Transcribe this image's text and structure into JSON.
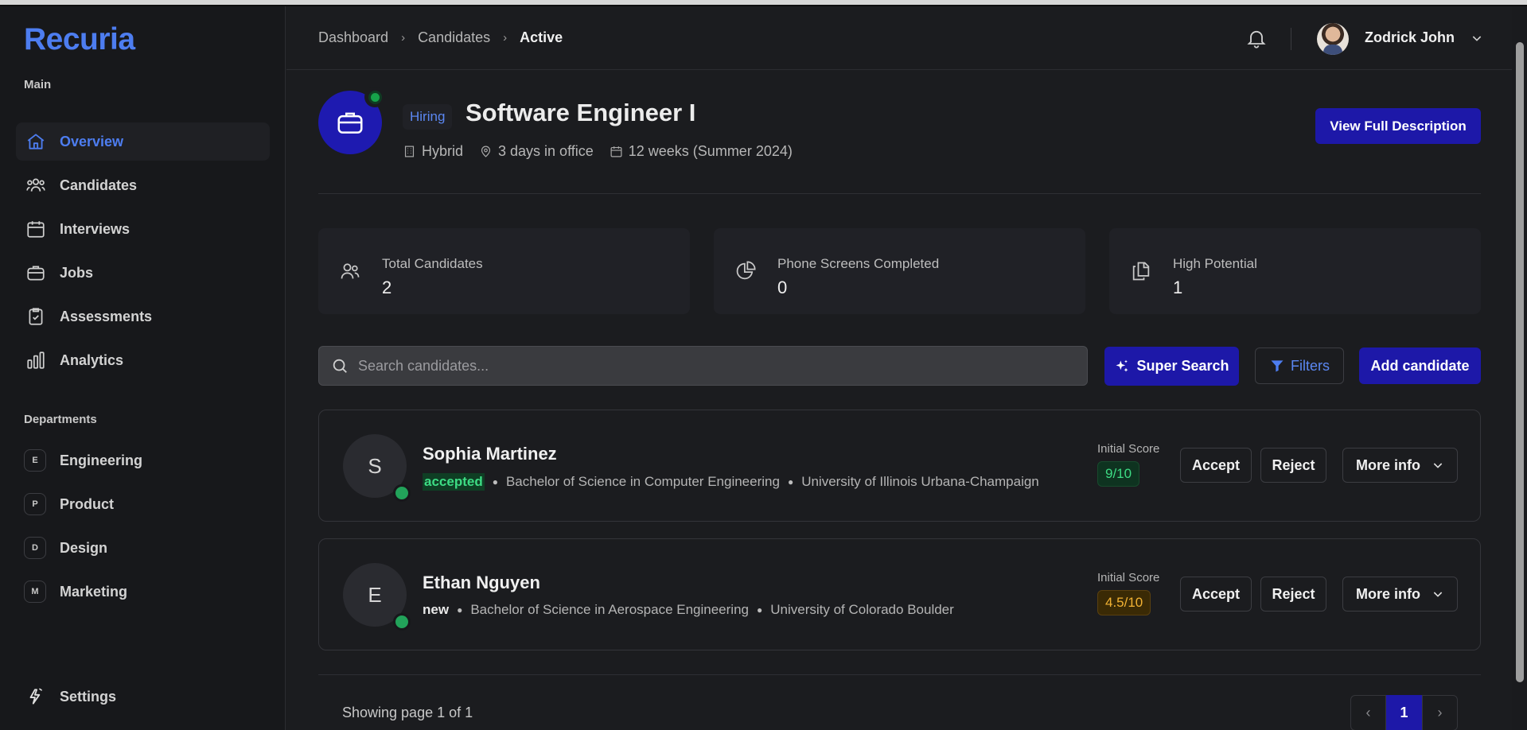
{
  "app": {
    "logo": "Recuria"
  },
  "sidebar": {
    "main_label": "Main",
    "items": [
      {
        "label": "Overview",
        "icon": "home-icon",
        "active": true
      },
      {
        "label": "Candidates",
        "icon": "users-icon"
      },
      {
        "label": "Interviews",
        "icon": "calendar-icon"
      },
      {
        "label": "Jobs",
        "icon": "briefcase-icon"
      },
      {
        "label": "Assessments",
        "icon": "clipboard-check-icon"
      },
      {
        "label": "Analytics",
        "icon": "bar-chart-icon"
      }
    ],
    "departments_label": "Departments",
    "departments": [
      {
        "letter": "E",
        "label": "Engineering"
      },
      {
        "letter": "P",
        "label": "Product"
      },
      {
        "letter": "D",
        "label": "Design"
      },
      {
        "letter": "M",
        "label": "Marketing"
      }
    ],
    "settings_label": "Settings"
  },
  "header": {
    "breadcrumb": [
      "Dashboard",
      "Candidates",
      "Active"
    ],
    "user_name": "Zodrick John"
  },
  "job": {
    "badge": "Hiring",
    "title": "Software Engineer I",
    "work_mode": "Hybrid",
    "office_days": "3 days in office",
    "duration": "12 weeks (Summer 2024)",
    "view_button": "View Full Description"
  },
  "stats": [
    {
      "label": "Total Candidates",
      "value": "2",
      "icon": "users-icon"
    },
    {
      "label": "Phone Screens Completed",
      "value": "0",
      "icon": "pie-chart-icon"
    },
    {
      "label": "High Potential",
      "value": "1",
      "icon": "copy-icon"
    }
  ],
  "toolbar": {
    "search_placeholder": "Search candidates...",
    "super_search": "Super Search",
    "filters": "Filters",
    "add_candidate": "Add candidate"
  },
  "candidates": [
    {
      "initial": "S",
      "name": "Sophia Martinez",
      "status": "accepted",
      "degree": "Bachelor of Science in Computer Engineering",
      "school": "University of Illinois Urbana-Champaign",
      "score_label": "Initial Score",
      "score": "9/10",
      "accept": "Accept",
      "reject": "Reject",
      "more": "More info"
    },
    {
      "initial": "E",
      "name": "Ethan Nguyen",
      "status": "new",
      "degree": "Bachelor of Science in Aerospace Engineering",
      "school": "University of Colorado Boulder",
      "score_label": "Initial Score",
      "score": "4.5/10",
      "accept": "Accept",
      "reject": "Reject",
      "more": "More info"
    }
  ],
  "pagination": {
    "text": "Showing page 1 of 1",
    "current": "1",
    "prev": "‹",
    "next": "›"
  },
  "colors": {
    "accent": "#4d7df0",
    "primary_button": "#1d18a8",
    "success": "#3ddc84",
    "warning": "#f2b233"
  }
}
